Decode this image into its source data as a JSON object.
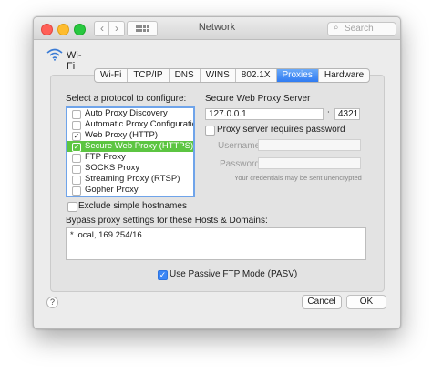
{
  "window": {
    "title": "Network",
    "search_placeholder": "Search"
  },
  "interface": {
    "name": "Wi-Fi",
    "icon": "wifi-icon"
  },
  "tabs": [
    {
      "label": "Wi-Fi",
      "active": false
    },
    {
      "label": "TCP/IP",
      "active": false
    },
    {
      "label": "DNS",
      "active": false
    },
    {
      "label": "WINS",
      "active": false
    },
    {
      "label": "802.1X",
      "active": false
    },
    {
      "label": "Proxies",
      "active": true
    },
    {
      "label": "Hardware",
      "active": false
    }
  ],
  "protocols": {
    "heading": "Select a protocol to configure:",
    "items": [
      {
        "label": "Auto Proxy Discovery",
        "checked": false,
        "selected": false
      },
      {
        "label": "Automatic Proxy Configuration",
        "checked": false,
        "selected": false
      },
      {
        "label": "Web Proxy (HTTP)",
        "checked": true,
        "selected": false
      },
      {
        "label": "Secure Web Proxy (HTTPS)",
        "checked": true,
        "selected": true
      },
      {
        "label": "FTP Proxy",
        "checked": false,
        "selected": false
      },
      {
        "label": "SOCKS Proxy",
        "checked": false,
        "selected": false
      },
      {
        "label": "Streaming Proxy (RTSP)",
        "checked": false,
        "selected": false
      },
      {
        "label": "Gopher Proxy",
        "checked": false,
        "selected": false
      }
    ]
  },
  "server": {
    "heading": "Secure Web Proxy Server",
    "host": "127.0.0.1",
    "separator": ":",
    "port": "4321",
    "requires_password_label": "Proxy server requires password",
    "requires_password": false,
    "username_label": "Username:",
    "username": "",
    "password_label": "Password:",
    "password": "",
    "hint": "Your credentials may be sent unencrypted"
  },
  "exclude_simple": {
    "label": "Exclude simple hostnames",
    "checked": false
  },
  "bypass": {
    "label": "Bypass proxy settings for these Hosts & Domains:",
    "value": "*.local, 169.254/16"
  },
  "passive_ftp": {
    "label": "Use Passive FTP Mode (PASV)",
    "checked": true
  },
  "footer": {
    "help": "?",
    "cancel": "Cancel",
    "ok": "OK"
  },
  "colors": {
    "accent": "#3b86f5",
    "selection": "#5cc542",
    "focus_ring": "#6fa4ea"
  }
}
